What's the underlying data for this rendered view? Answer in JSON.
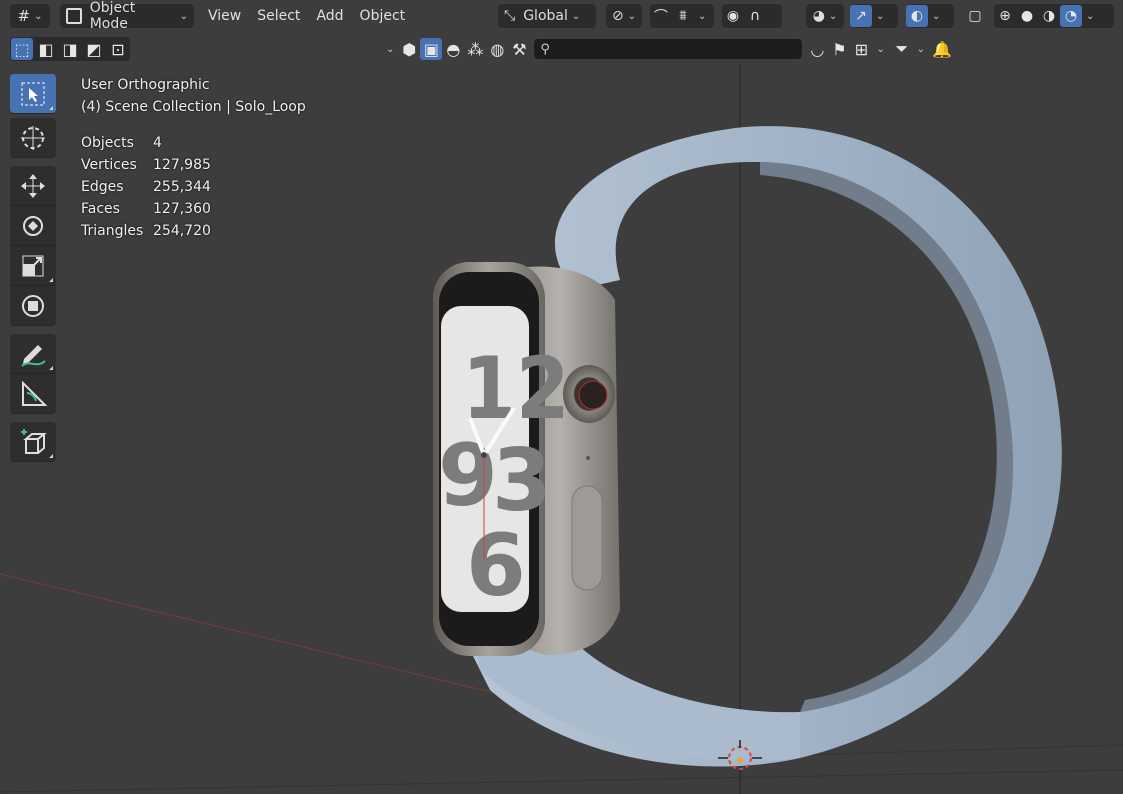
{
  "header": {
    "mode_label": "Object Mode",
    "menu": [
      "View",
      "Select",
      "Add",
      "Object"
    ],
    "transform_orientation": "Global"
  },
  "viewport": {
    "view_name": "User Orthographic",
    "collection_info": "(4) Scene Collection | Solo_Loop",
    "stats": [
      {
        "label": "Objects",
        "value": "4"
      },
      {
        "label": "Vertices",
        "value": "127,985"
      },
      {
        "label": "Edges",
        "value": "255,344"
      },
      {
        "label": "Faces",
        "value": "127,360"
      },
      {
        "label": "Triangles",
        "value": "254,720"
      }
    ],
    "watch_numerals": [
      "12",
      "9",
      "3",
      "6"
    ]
  },
  "toolbar": {
    "tools": [
      "select-box",
      "cursor",
      "move",
      "rotate",
      "scale",
      "transform",
      "annotate",
      "measure",
      "add-cube"
    ],
    "active_tool": "select-box"
  },
  "colors": {
    "accent": "#4772b3",
    "viewport_bg": "#3d3d3d",
    "band": "#a6b8cb",
    "x_axis": "#8a3a3a"
  }
}
